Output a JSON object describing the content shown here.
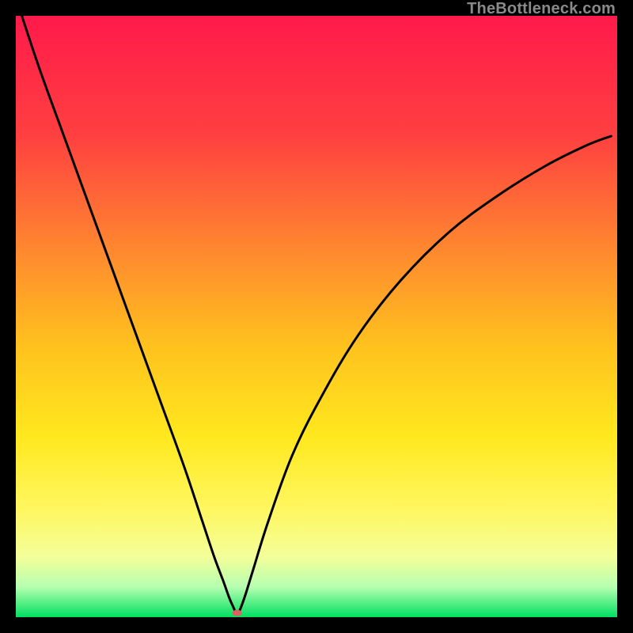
{
  "watermark": "TheBottleneck.com",
  "chart_data": {
    "type": "line",
    "title": "",
    "xlabel": "",
    "ylabel": "",
    "xlim": [
      0,
      100
    ],
    "ylim": [
      0,
      100
    ],
    "grid": false,
    "legend": false,
    "background_gradient": {
      "stops": [
        {
          "pos": 0.0,
          "color": "#ff1a4b"
        },
        {
          "pos": 0.2,
          "color": "#ff4040"
        },
        {
          "pos": 0.4,
          "color": "#ff8c2e"
        },
        {
          "pos": 0.55,
          "color": "#ffc21e"
        },
        {
          "pos": 0.7,
          "color": "#ffe81e"
        },
        {
          "pos": 0.82,
          "color": "#fff760"
        },
        {
          "pos": 0.9,
          "color": "#f3ff9a"
        },
        {
          "pos": 0.95,
          "color": "#b6ffb0"
        },
        {
          "pos": 1.0,
          "color": "#00e060"
        }
      ]
    },
    "series": [
      {
        "name": "bottleneck-curve",
        "color": "#000000",
        "x": [
          1,
          4,
          8,
          12,
          16,
          20,
          24,
          28,
          31,
          33,
          34.5,
          35.5,
          36.2,
          36.6,
          37.0,
          37.5,
          38.2,
          39.5,
          42,
          46,
          51,
          57,
          64,
          72,
          80,
          88,
          95,
          99
        ],
        "y": [
          100,
          91,
          80,
          69,
          58,
          47,
          36,
          25,
          16,
          10,
          6,
          3.2,
          1.6,
          0.7,
          0.7,
          1.8,
          3.8,
          8,
          16,
          27,
          37,
          47,
          56,
          64,
          70,
          75,
          78.5,
          80
        ]
      }
    ],
    "markers": [
      {
        "name": "min-marker",
        "x": 36.8,
        "y": 0.7,
        "color": "#e06060",
        "rx": 6,
        "ry": 4
      }
    ]
  }
}
